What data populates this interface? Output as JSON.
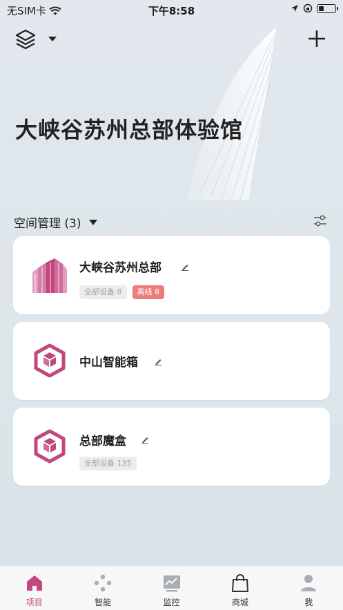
{
  "status_bar": {
    "carrier": "无SIM卡",
    "time": "下午8:58",
    "battery_level": 0.3
  },
  "header": {
    "title": "大峡谷苏州总部体验馆"
  },
  "section": {
    "label": "空间管理 (3)"
  },
  "spaces": [
    {
      "name": "大峡谷苏州总部",
      "icon": "building-icon",
      "tags": [
        {
          "text": "全部设备 8",
          "style": "gray"
        },
        {
          "text": "离线 8",
          "style": "red"
        }
      ]
    },
    {
      "name": "中山智能箱",
      "icon": "cube-icon",
      "tags": []
    },
    {
      "name": "总部魔盒",
      "icon": "cube-icon",
      "tags": [
        {
          "text": "全部设备 135",
          "style": "gray"
        }
      ]
    }
  ],
  "tabbar": [
    {
      "label": "项目",
      "icon": "home-icon",
      "active": true
    },
    {
      "label": "智能",
      "icon": "dots-icon",
      "active": false
    },
    {
      "label": "监控",
      "icon": "chart-icon",
      "active": false
    },
    {
      "label": "商城",
      "icon": "bag-icon",
      "active": false
    },
    {
      "label": "我",
      "icon": "person-icon",
      "active": false
    }
  ],
  "colors": {
    "accent": "#c2477c",
    "offline_tag": "#ef7a7a",
    "tag_gray_bg": "#ececee"
  }
}
